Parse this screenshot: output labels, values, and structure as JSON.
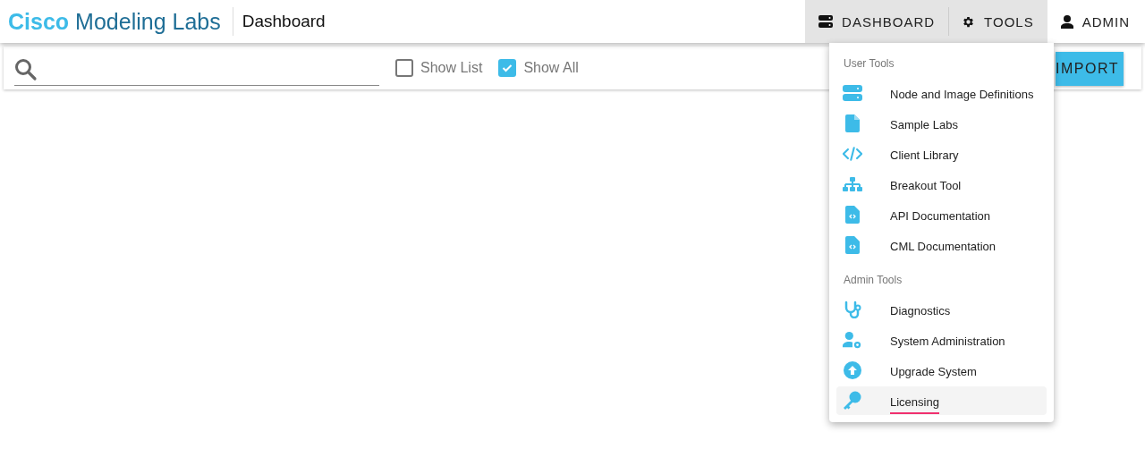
{
  "header": {
    "brand_bold": "Cisco",
    "brand_rest": "Modeling Labs",
    "page_title": "Dashboard",
    "nav": [
      {
        "label": "DASHBOARD",
        "active": true
      },
      {
        "label": "TOOLS",
        "active": true
      },
      {
        "label": "ADMIN",
        "active": false
      }
    ]
  },
  "toolbar": {
    "show_list": {
      "label": "Show List",
      "checked": false
    },
    "show_all": {
      "label": "Show All",
      "checked": true
    },
    "import_button": "IMPORT"
  },
  "tools_menu": {
    "sections": [
      {
        "title": "User Tools",
        "items": [
          {
            "label": "Node and Image Definitions",
            "selected": false
          },
          {
            "label": "Sample Labs",
            "selected": false
          },
          {
            "label": "Client Library",
            "selected": false
          },
          {
            "label": "Breakout Tool",
            "selected": false
          },
          {
            "label": "API Documentation",
            "selected": false
          },
          {
            "label": "CML Documentation",
            "selected": false
          }
        ]
      },
      {
        "title": "Admin Tools",
        "items": [
          {
            "label": "Diagnostics",
            "selected": false
          },
          {
            "label": "System Administration",
            "selected": false
          },
          {
            "label": "Upgrade System",
            "selected": false
          },
          {
            "label": "Licensing",
            "selected": true
          }
        ]
      }
    ]
  }
}
